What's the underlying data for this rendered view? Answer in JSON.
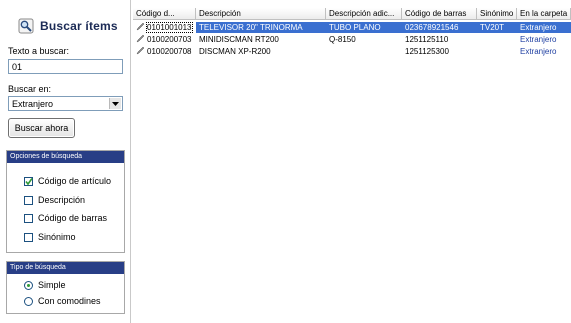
{
  "panel": {
    "title": "Buscar ítems",
    "search_label": "Texto a buscar:",
    "search_value": "01",
    "search_in_label": "Buscar en:",
    "search_in_value": "Extranjero",
    "search_button": "Buscar ahora"
  },
  "options": {
    "header": "Opciones de búsqueda",
    "items": [
      {
        "label": "Código de artículo",
        "checked": true
      },
      {
        "label": "Descripción",
        "checked": false
      },
      {
        "label": "Código de barras",
        "checked": false
      },
      {
        "label": "Sinónimo",
        "checked": false
      }
    ]
  },
  "search_type": {
    "header": "Tipo de búsqueda",
    "items": [
      {
        "label": "Simple",
        "selected": true
      },
      {
        "label": "Con comodines",
        "selected": false
      }
    ]
  },
  "grid": {
    "columns": [
      "Código d...",
      "Descripción",
      "Descripción adic...",
      "Código de barras",
      "Sinónimo",
      "En la carpeta"
    ],
    "rows": [
      {
        "code": "0101001013",
        "description": "TELEVISOR 20\" TRINORMA",
        "extra": "TUBO PLANO",
        "barcode": "023678921546",
        "synonym": "TV20T",
        "folder": "Extranjero",
        "selected": true
      },
      {
        "code": "0100200703",
        "description": "MINIDISCMAN RT200",
        "extra": "Q-8150",
        "barcode": "1251125110",
        "synonym": "",
        "folder": "Extranjero",
        "selected": false
      },
      {
        "code": "0100200708",
        "description": "DISCMAN XP-R200",
        "extra": "",
        "barcode": "1251125300",
        "synonym": "",
        "folder": "Extranjero",
        "selected": false
      }
    ]
  },
  "colors": {
    "group_header": "#283e86",
    "selection": "#3a6fd0",
    "folder_text": "#1f3fa2",
    "check_tick": "#2f9a37"
  },
  "icons": {
    "panel": "search-magnifier-icon",
    "row": "item-pen-icon",
    "dropdown": "chevron-down-icon",
    "check": "check-icon"
  }
}
